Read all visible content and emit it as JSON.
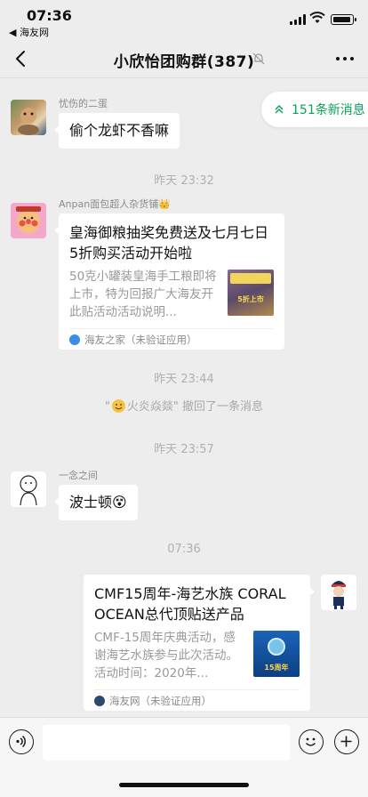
{
  "status": {
    "time": "07:36",
    "back_app": "◀ 海友网"
  },
  "nav": {
    "title": "小欣怡团购群(387)"
  },
  "new_messages": {
    "label": "151条新消息"
  },
  "messages": {
    "m1": {
      "sender": "忧伤的二蛋",
      "text": "偷个龙虾不香嘛"
    },
    "t1": "昨天 23:32",
    "m2": {
      "sender": "Anpan面包超人杂货铺👑",
      "title": "皇海御粮抽奖免费送及七月七日5折购买活动开始啦",
      "desc": "50克小罐装皇海手工粮即将上市，特为回报广大海友开此贴活动活动说明...",
      "thumb_text": "5折上市",
      "source": "海友之家（未验证应用）"
    },
    "t2": "昨天 23:44",
    "recall": {
      "name_prefix": "\"",
      "name": "火炎焱燚\"",
      "text": " 撤回了一条消息"
    },
    "t3": "昨天 23:57",
    "m3": {
      "sender": "一念之间",
      "text": "波士顿😵"
    },
    "t4": "07:36",
    "m4": {
      "title": "CMF15周年-海艺水族 CORAL OCEAN总代顶贴送产品",
      "desc": "CMF-15周年庆典活动，感谢海艺水族参与此次活动。活动时间：2020年...",
      "thumb_text": "15周年",
      "source": "海友网（未验证应用）"
    }
  },
  "colors": {
    "accent": "#07a35a",
    "background": "#ededed",
    "bubble": "#ffffff"
  }
}
